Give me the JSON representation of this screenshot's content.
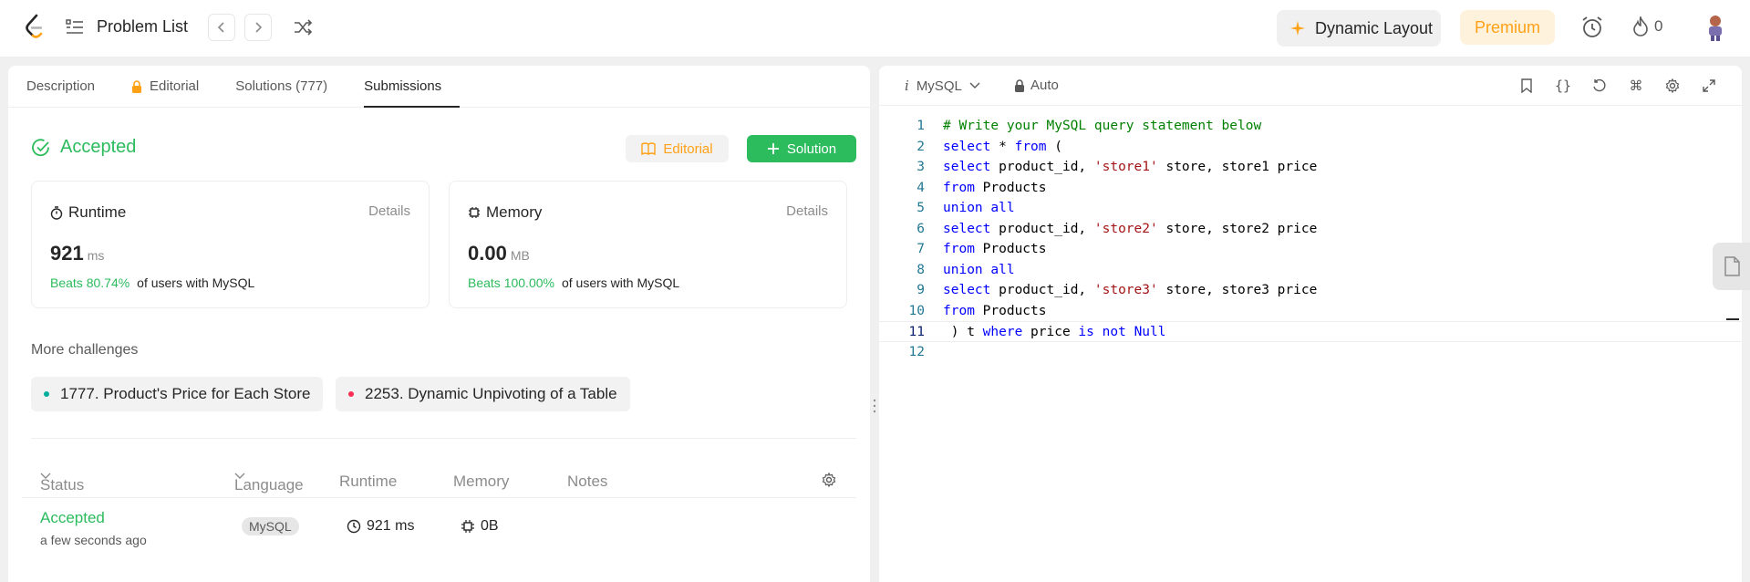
{
  "nav": {
    "problem_list": "Problem List",
    "dynamic_layout": "Dynamic Layout",
    "premium": "Premium",
    "streak_count": "0"
  },
  "tabs": [
    {
      "label": "Description"
    },
    {
      "label": "Editorial"
    },
    {
      "label": "Solutions (777)"
    },
    {
      "label": "Submissions"
    }
  ],
  "result": {
    "status": "Accepted",
    "editorial_button": "Editorial",
    "solution_button": "Solution"
  },
  "runtime": {
    "title": "Runtime",
    "details": "Details",
    "value": "921",
    "unit": "ms",
    "beats_pct": "Beats 80.74%",
    "beats_suffix": "of users with MySQL"
  },
  "memory": {
    "title": "Memory",
    "details": "Details",
    "value": "0.00",
    "unit": "MB",
    "beats_pct": "Beats 100.00%",
    "beats_suffix": "of users with MySQL"
  },
  "challenges": {
    "title": "More challenges",
    "items": [
      {
        "label": "1777. Product's Price for Each Store",
        "color": "#00af9b"
      },
      {
        "label": "2253. Dynamic Unpivoting of a Table",
        "color": "#ff2d55"
      }
    ]
  },
  "submissions": {
    "headers": {
      "status": "Status",
      "language": "Language",
      "runtime": "Runtime",
      "memory": "Memory",
      "notes": "Notes"
    },
    "rows": [
      {
        "status": "Accepted",
        "time": "a few seconds ago",
        "language": "MySQL",
        "runtime": "921 ms",
        "memory": "0B"
      }
    ]
  },
  "editor": {
    "language": "MySQL",
    "mode": "Auto",
    "active_line": 11,
    "lines": [
      "# Write your MySQL query statement below",
      "select * from (",
      "select product_id, 'store1' store, store1 price",
      "from Products",
      "union all",
      "select product_id, 'store2' store, store2 price",
      "from Products",
      "union all",
      "select product_id, 'store3' store, store3 price",
      "from Products",
      " ) t where price is not Null",
      ""
    ]
  },
  "colors": {
    "accent_green": "#2cbb5d",
    "brand_orange": "#ffa116"
  }
}
